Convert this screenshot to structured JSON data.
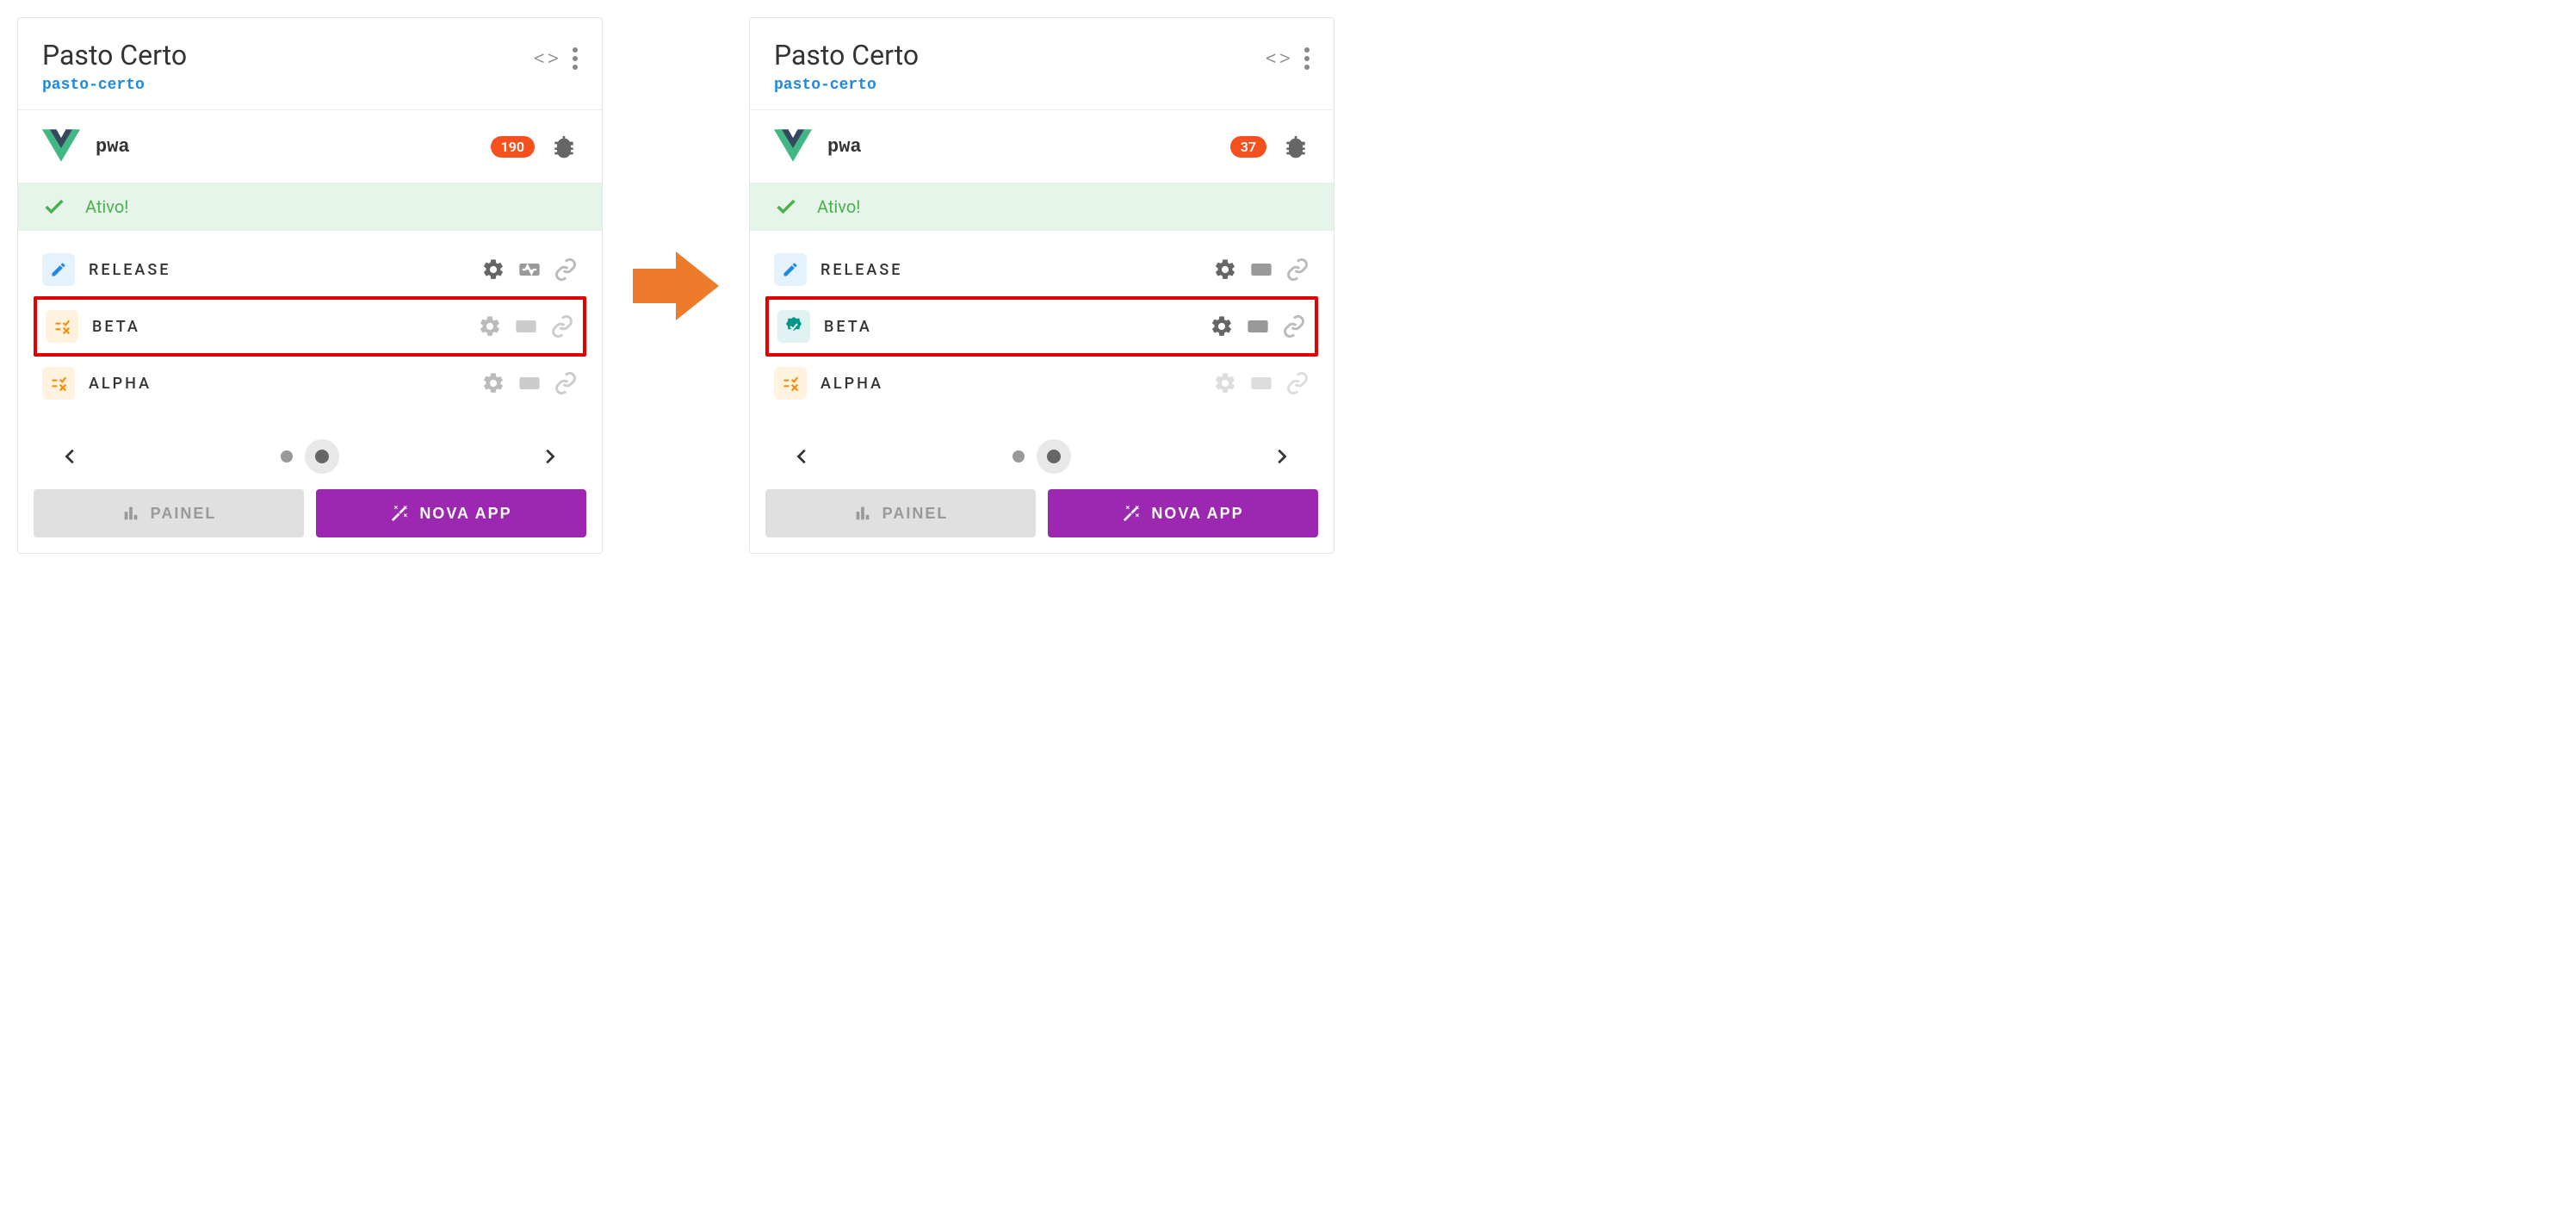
{
  "cards": {
    "left": {
      "title": "Pasto Certo",
      "slug": "pasto-certo",
      "app_name": "pwa",
      "badge_count": "190",
      "status": "Ativo!",
      "channels": [
        {
          "name": "RELEASE",
          "icon": "pencil",
          "highlight": false,
          "muted": false
        },
        {
          "name": "BETA",
          "icon": "checklist",
          "highlight": true,
          "muted": false
        },
        {
          "name": "ALPHA",
          "icon": "checklist",
          "highlight": false,
          "muted": false
        }
      ]
    },
    "right": {
      "title": "Pasto Certo",
      "slug": "pasto-certo",
      "app_name": "pwa",
      "badge_count": "37",
      "status": "Ativo!",
      "channels": [
        {
          "name": "RELEASE",
          "icon": "pencil",
          "highlight": false,
          "muted": false
        },
        {
          "name": "BETA",
          "icon": "verified",
          "highlight": true,
          "muted": false
        },
        {
          "name": "ALPHA",
          "icon": "checklist",
          "highlight": false,
          "muted": true
        }
      ]
    }
  },
  "buttons": {
    "painel": "PAINEL",
    "nova_app": "NOVA APP"
  }
}
